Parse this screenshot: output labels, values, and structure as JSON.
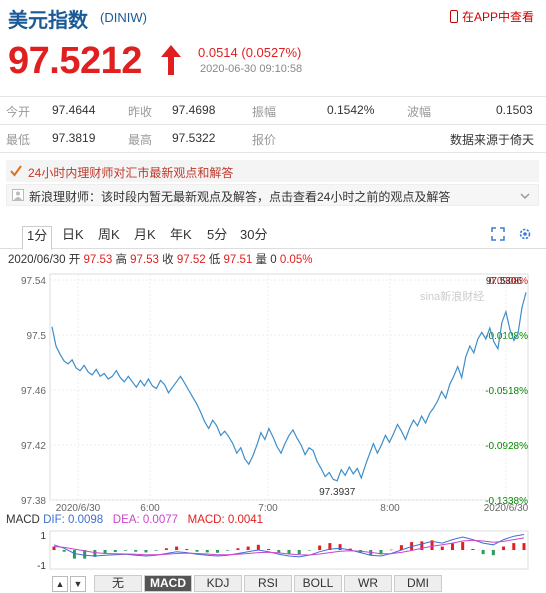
{
  "header": {
    "title": "美元指数",
    "code": "(DINIW)",
    "app_link": "在APP中查看",
    "icon_phone": "phone-icon"
  },
  "quote": {
    "price": "97.5212",
    "change": "0.0514 (0.0527%)",
    "time": "2020-06-30 09:10:58",
    "direction": "up",
    "up_color": "#e02020"
  },
  "stats": [
    [
      {
        "label": "今开",
        "value": "97.4644"
      },
      {
        "label": "昨收",
        "value": "97.4698"
      },
      {
        "label": "振幅",
        "value": "0.1542%"
      },
      {
        "label": "波幅",
        "value": "0.1503"
      }
    ],
    [
      {
        "label": "最低",
        "value": "97.3819"
      },
      {
        "label": "最高",
        "value": "97.5322"
      },
      {
        "label": "报价",
        "value": "数据来源于倚天"
      }
    ]
  ],
  "tip": {
    "text": "24小时内理财师对汇市最新观点和解答"
  },
  "note": {
    "text": "新浪理财师：该时段内暂无最新观点及解答，点击查看24小时之前的观点及解答"
  },
  "tabs": [
    "1分",
    "日K",
    "周K",
    "月K",
    "年K",
    "5分",
    "30分"
  ],
  "active_tab": 0,
  "ohlc": {
    "date": "2020/06/30",
    "open_label": "开",
    "open": "97.53",
    "high_label": "高",
    "high": "97.53",
    "close_label": "收",
    "close": "97.52",
    "low_label": "低",
    "low": "97.51",
    "vol_label": "量",
    "vol": "0",
    "pct": "0.05%"
  },
  "chart_data": {
    "type": "line",
    "y_ticks": [
      "97.54",
      "97.5",
      "97.46",
      "97.42",
      "97.38"
    ],
    "pct_ticks": [
      "0.0908%",
      "-0.0108%",
      "-0.0518%",
      "-0.0928%",
      "-0.1338%"
    ],
    "pct_colors": [
      "#e02020",
      "#008800",
      "#008800",
      "#008800",
      "#008800"
    ],
    "x_ticks": [
      "2020/6/30",
      "6:00",
      "7:00",
      "8:00",
      "2020/6/30"
    ],
    "ylim": [
      97.38,
      97.54
    ],
    "watermark": "sina新浪财经",
    "last_label": "97.5306",
    "min_label": "97.3937",
    "line_color": "#3d8ec9",
    "series": [
      {
        "values": [
          97.506,
          97.492,
          97.486,
          97.481,
          97.479,
          97.482,
          97.476,
          97.474,
          97.478,
          97.473,
          97.471,
          97.475,
          97.47,
          97.472,
          97.468,
          97.47,
          97.474,
          97.469,
          97.466,
          97.47,
          97.466,
          97.462,
          97.467,
          97.463,
          97.468,
          97.463,
          97.461,
          97.467,
          97.464,
          97.458,
          97.462,
          97.466,
          97.47,
          97.465,
          97.46,
          97.455,
          97.45,
          97.444,
          97.437,
          97.432,
          97.438,
          97.434,
          97.427,
          97.43,
          97.426,
          97.421,
          97.414,
          97.418,
          97.41,
          97.406,
          97.412,
          97.42,
          97.429,
          97.424,
          97.432,
          97.426,
          97.419,
          97.414,
          97.421,
          97.427,
          97.431,
          97.425,
          97.42,
          97.413,
          97.418,
          97.416,
          97.408,
          97.403,
          97.397,
          97.4,
          97.395,
          97.394,
          97.402,
          97.398,
          97.404,
          97.399,
          97.403,
          97.396,
          97.405,
          97.413,
          97.421,
          97.414,
          97.42,
          97.427,
          97.422,
          97.428,
          97.435,
          97.43,
          97.424,
          97.432,
          97.438,
          97.434,
          97.441,
          97.436,
          97.443,
          97.447,
          97.452,
          97.459,
          97.454,
          97.464,
          97.47,
          97.477,
          97.469,
          97.484,
          97.492,
          97.487,
          97.497,
          97.502,
          97.497,
          97.505,
          97.495,
          97.49,
          97.509,
          97.517,
          97.504,
          97.496,
          97.501,
          97.52,
          97.531
        ]
      }
    ],
    "macd": {
      "dif_label": "DIF:",
      "dif": "0.0098",
      "dif_color": "#3d6fd6",
      "dea_label": "DEA:",
      "dea": "0.0077",
      "dea_color": "#cc44cc",
      "macd_label": "MACD:",
      "macd": "0.0041",
      "macd_color": "#e02020",
      "title": "MACD",
      "y_ticks": [
        "1",
        "-1"
      ],
      "dif_values": [
        0.3,
        0.1,
        -0.2,
        -0.3,
        -0.35,
        -0.3,
        -0.28,
        -0.25,
        -0.3,
        -0.35,
        -0.3,
        -0.2,
        -0.1,
        -0.15,
        -0.25,
        -0.3,
        -0.35,
        -0.3,
        -0.2,
        -0.1,
        0.0,
        -0.1,
        -0.25,
        -0.35,
        -0.4,
        -0.3,
        -0.1,
        0.05,
        0.1,
        0.0,
        -0.15,
        -0.3,
        -0.35,
        -0.2,
        0.0,
        0.2,
        0.35,
        0.5,
        0.4,
        0.6,
        0.75,
        0.6,
        0.4,
        0.3,
        0.6,
        0.8,
        0.9
      ],
      "dea_values": [
        0.2,
        0.15,
        0.05,
        -0.05,
        -0.15,
        -0.2,
        -0.22,
        -0.23,
        -0.25,
        -0.28,
        -0.28,
        -0.25,
        -0.2,
        -0.18,
        -0.2,
        -0.23,
        -0.27,
        -0.28,
        -0.25,
        -0.2,
        -0.15,
        -0.13,
        -0.17,
        -0.23,
        -0.28,
        -0.29,
        -0.23,
        -0.15,
        -0.07,
        -0.04,
        -0.07,
        -0.14,
        -0.22,
        -0.21,
        -0.14,
        -0.03,
        0.1,
        0.22,
        0.3,
        0.4,
        0.52,
        0.57,
        0.52,
        0.45,
        0.5,
        0.6,
        0.7
      ]
    }
  },
  "indicator_tabs": [
    "无",
    "MACD",
    "KDJ",
    "RSI",
    "BOLL",
    "WR",
    "DMI"
  ],
  "active_indicator": 1,
  "nav_arrows": [
    "▲",
    "▼"
  ]
}
